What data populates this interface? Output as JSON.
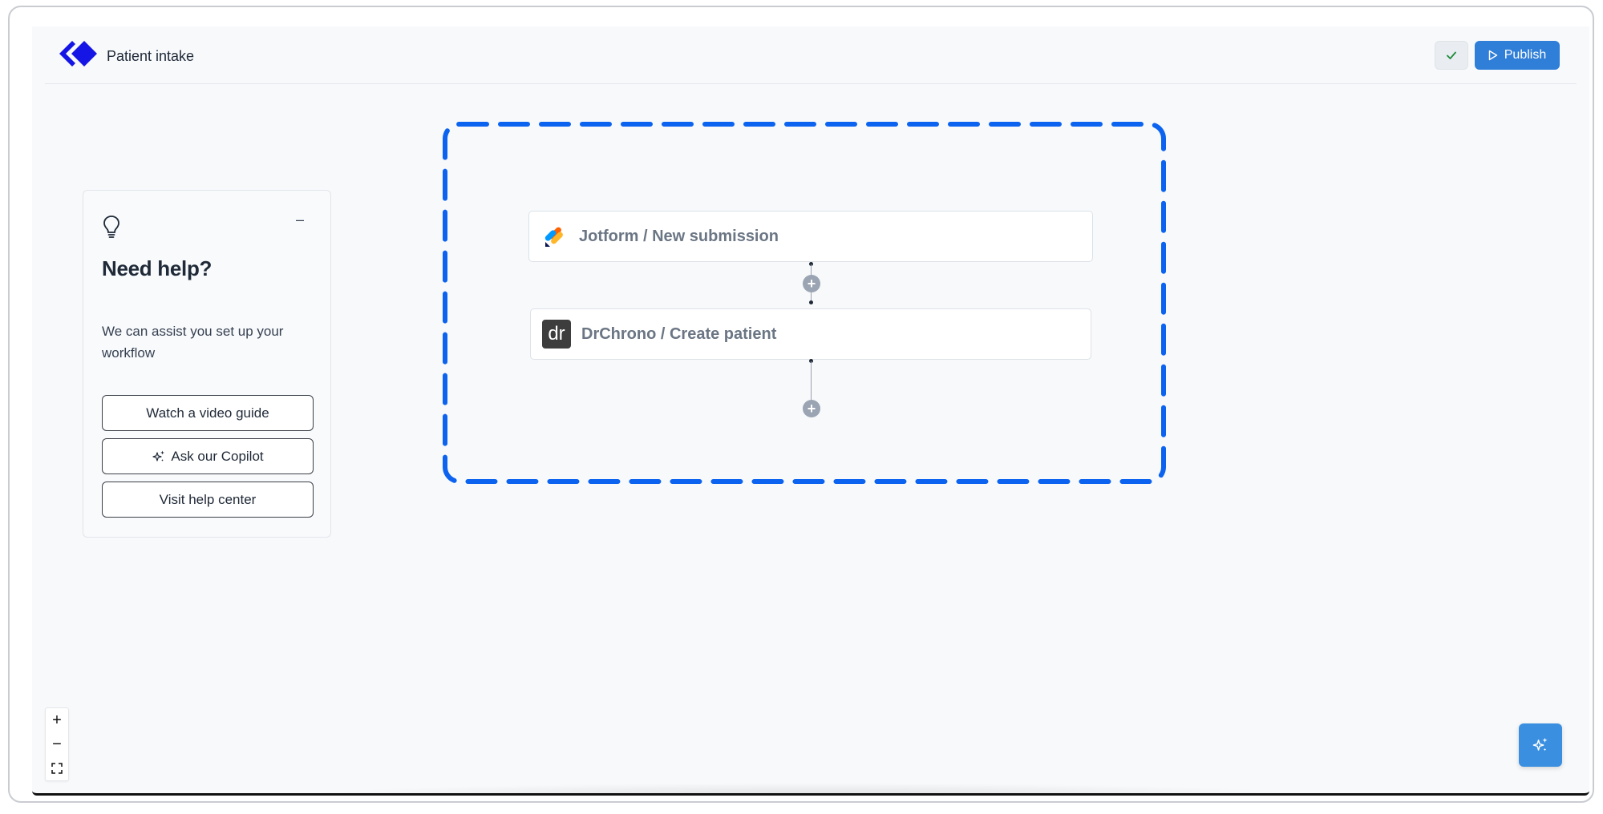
{
  "header": {
    "title": "Patient intake",
    "publish_label": "Publish"
  },
  "help_card": {
    "title": "Need help?",
    "description": "We can assist you set up your workflow",
    "buttons": [
      {
        "label": "Watch a video guide"
      },
      {
        "label": "Ask our Copilot"
      },
      {
        "label": "Visit help center"
      }
    ]
  },
  "workflow": {
    "nodes": [
      {
        "label": "Jotform / New submission",
        "icon": "jotform-icon"
      },
      {
        "label": "DrChrono / Create patient",
        "icon": "drchrono-icon",
        "icon_text": "dr"
      }
    ]
  },
  "zoom": {
    "in": "+",
    "out": "−"
  },
  "colors": {
    "accent": "#2f7ed8",
    "selection_dash": "#0b63f0",
    "logo": "#1515e6",
    "canvas_bg": "#f7f9fb"
  }
}
